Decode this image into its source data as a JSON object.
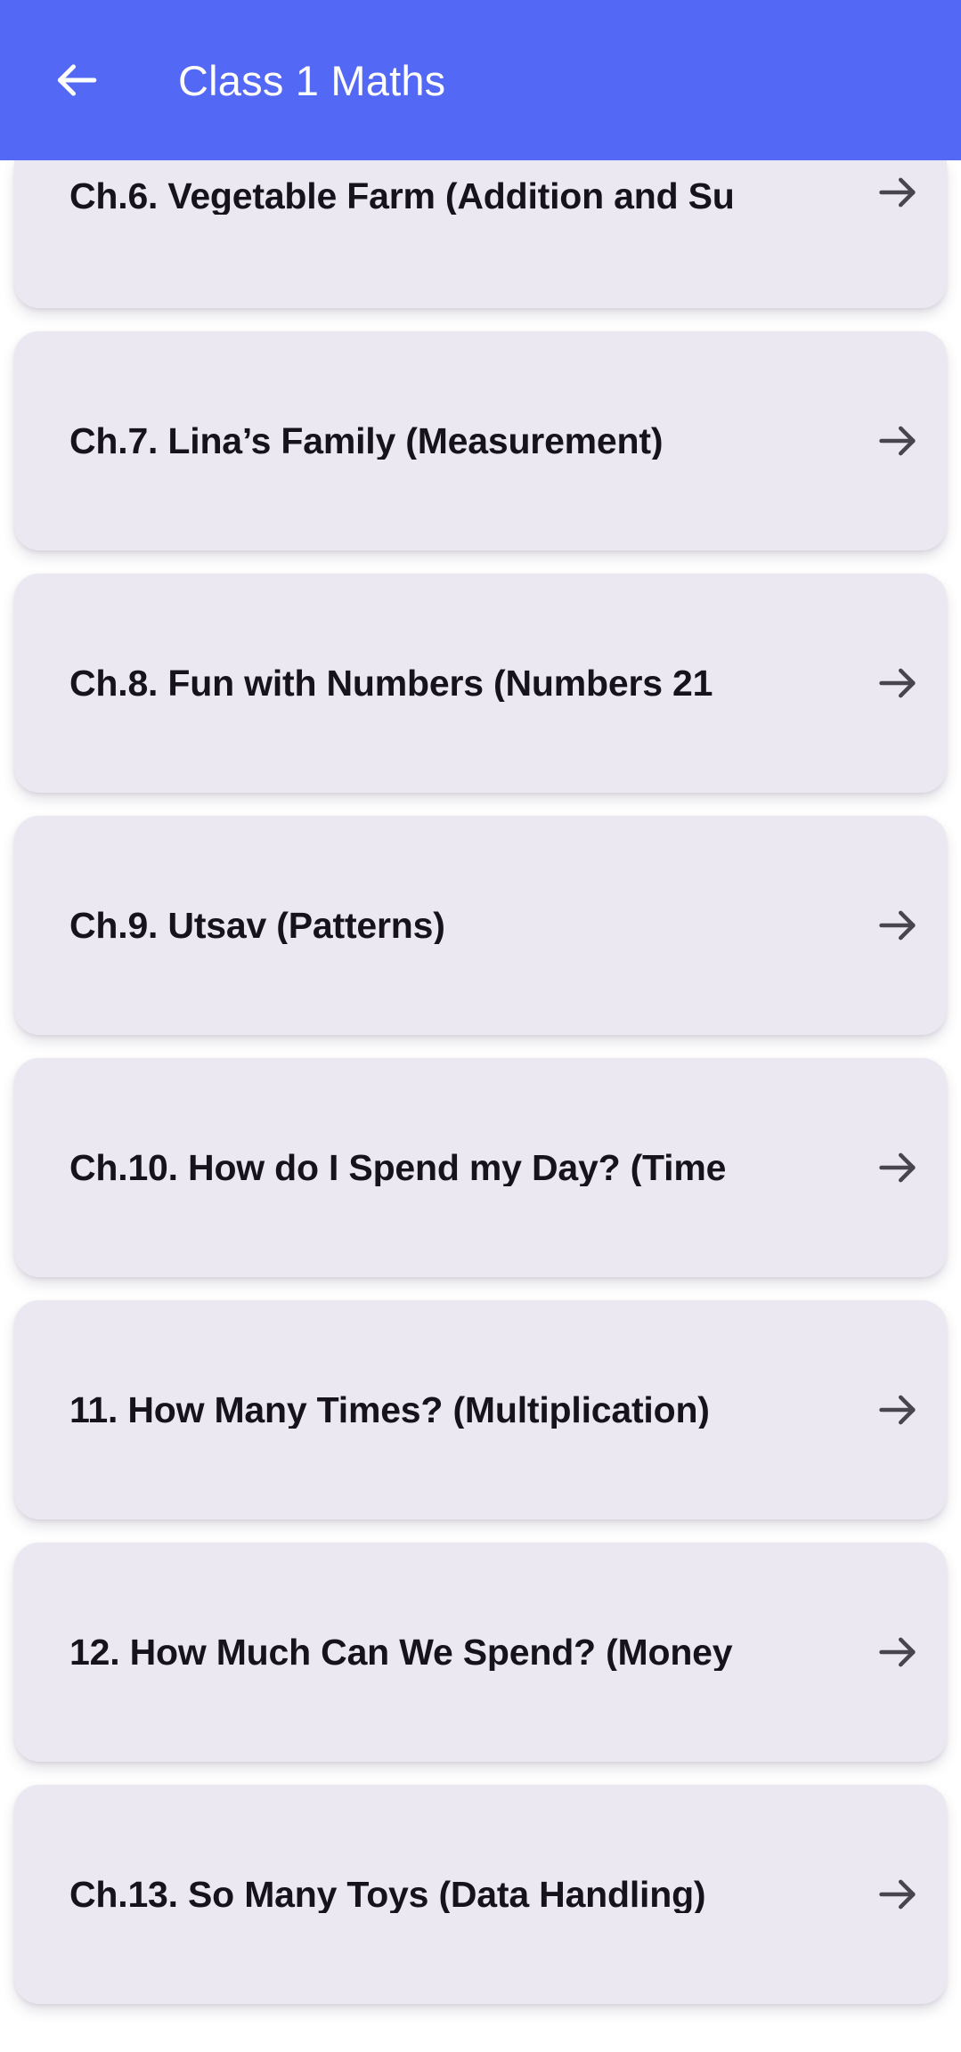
{
  "appbar": {
    "title": "Class 1 Maths",
    "back_icon": "arrow-left-icon",
    "background_color": "#5468F6",
    "title_color": "#FFFFFF"
  },
  "theme": {
    "page_background": "#FFFFFF",
    "card_background": "#EBE8F1",
    "card_text_color": "#16131A",
    "arrow_color": "#49454F",
    "accent": "#5468F6"
  },
  "list": {
    "trailing_icon": "arrow-right-icon",
    "items": [
      {
        "label": "Ch.6. Vegetable Farm (Addition and Su",
        "truncated": true,
        "partially_scrolled": true
      },
      {
        "label": "Ch.7. Lina’s Family (Measurement)",
        "truncated": false,
        "partially_scrolled": false
      },
      {
        "label": "Ch.8. Fun with Numbers (Numbers 21",
        "truncated": true,
        "partially_scrolled": false
      },
      {
        "label": "Ch.9. Utsav (Patterns)",
        "truncated": false,
        "partially_scrolled": false
      },
      {
        "label": "Ch.10. How do I Spend my Day? (Time",
        "truncated": true,
        "partially_scrolled": false
      },
      {
        "label": "11. How Many Times? (Multiplication)",
        "truncated": false,
        "partially_scrolled": false
      },
      {
        "label": "12. How Much Can We Spend? (Money",
        "truncated": true,
        "partially_scrolled": false
      },
      {
        "label": "Ch.13. So Many Toys (Data Handling)",
        "truncated": false,
        "partially_scrolled": false
      }
    ]
  }
}
